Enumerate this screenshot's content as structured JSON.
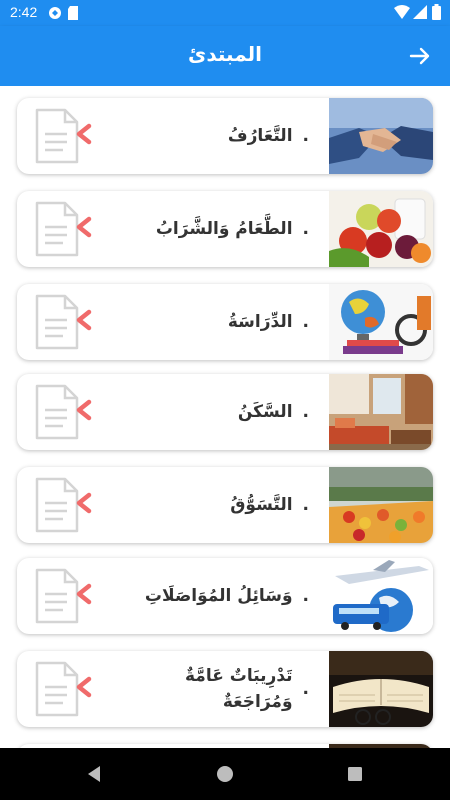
{
  "status": {
    "time": "2:42"
  },
  "appbar": {
    "title": "المبتدئ"
  },
  "lessons": [
    {
      "label": "التَّعَارُفُ",
      "dot": ".",
      "image": "handshake"
    },
    {
      "label": "الطَّعَامُ وَالشَّرَابُ",
      "dot": ".",
      "image": "food-and-drink"
    },
    {
      "label": "الدِّرَاسَةُ",
      "dot": ".",
      "image": "globe-and-books"
    },
    {
      "label": "السَّكَنُ",
      "dot": ".",
      "image": "living-room"
    },
    {
      "label": "التَّسَوُّقُ",
      "dot": ".",
      "image": "supermarket"
    },
    {
      "label": "وَسَائِلُ المُوَاصَلَاتِ",
      "dot": ".",
      "image": "airplane-bus-globe"
    },
    {
      "label": "تَدْرِيبَاتٌ عَامَّةٌ وَمُرَاجَعَةٌ",
      "dot": ".",
      "image": "open-book-glasses"
    }
  ],
  "colors": {
    "primary": "#1f8df0",
    "chevron": "#f06b6b",
    "doc": "#cfcfcf"
  }
}
